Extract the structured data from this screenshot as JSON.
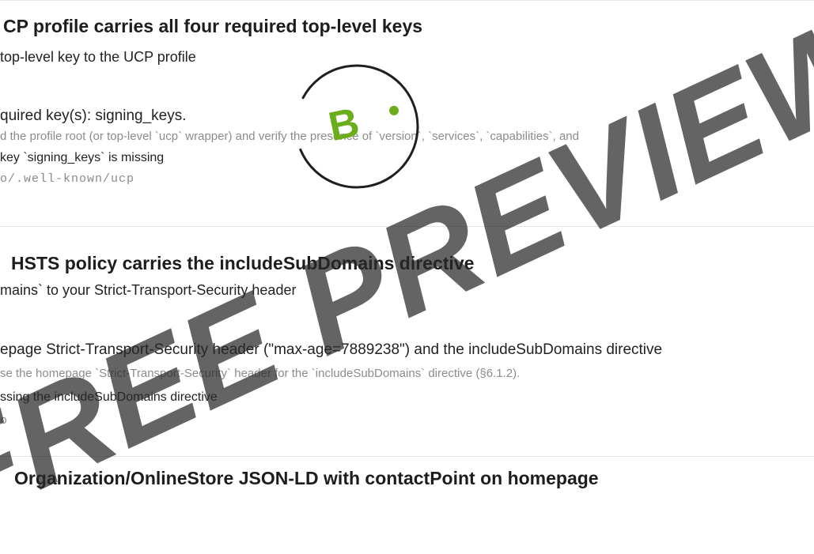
{
  "checks": [
    {
      "heading": "CP profile carries all four required top-level keys",
      "recommendation": "top-level key to the UCP profile",
      "reason": "quired key(s): signing_keys.",
      "method": "d the profile root (or top-level `ucp` wrapper) and verify the presence of `version`, `services`, `capabilities`, and",
      "evidence": "key `signing_keys` is missing",
      "url": "o/.well-known/ucp"
    },
    {
      "heading": "HSTS policy carries the includeSubDomains directive",
      "recommendation": "mains` to your Strict-Transport-Security header",
      "reason": "epage Strict-Transport-Security header (\"max-age=7889238\") and the includeSubDomains directive",
      "method": "se the homepage `Strict-Transport-Security` header for the `includeSubDomains` directive (§6.1.2).",
      "evidence": "ssing the includeSubDomains directive",
      "url": "o"
    },
    {
      "heading": "Organization/OnlineStore JSON-LD with contactPoint on homepage"
    }
  ],
  "grade": {
    "letter": "B",
    "ring_color": "#1f1f1f",
    "accent_color": "#6cad1c",
    "progress_fraction": 0.86
  },
  "watermark": "FREE PREVIEW"
}
